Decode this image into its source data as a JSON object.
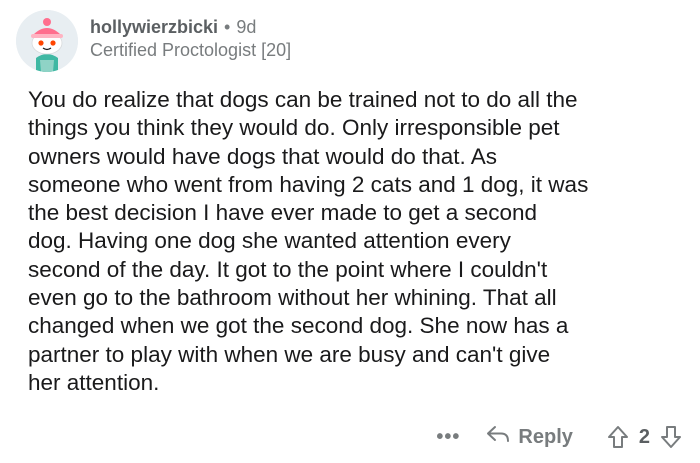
{
  "comment": {
    "author": "hollywierzbicki",
    "separator": "•",
    "age": "9d",
    "flair": "Certified Proctologist [20]",
    "body": "You do realize that dogs can be trained not to do all the\nthings you think they would do. Only irresponsible pet\nowners would have dogs that would do that. As\nsomeone who went from having 2 cats and 1 dog, it was\nthe best decision I have ever made to get a second\ndog. Having one dog she wanted attention every\nsecond of the day. It got to the point where I couldn't\neven go to the bathroom without her whining. That all\nchanged when we got the second dog. She now has a\npartner to play with when we are busy and can't give\nher attention."
  },
  "actions": {
    "more_label": "•••",
    "reply_label": "Reply",
    "score": "2",
    "reply_icon": "reply-arrow-icon",
    "upvote_icon": "upvote-arrow-icon",
    "downvote_icon": "downvote-arrow-icon"
  },
  "colors": {
    "text": "#1a1a1b",
    "muted": "#787c7e",
    "avatar_bg": "#e8eef2"
  }
}
